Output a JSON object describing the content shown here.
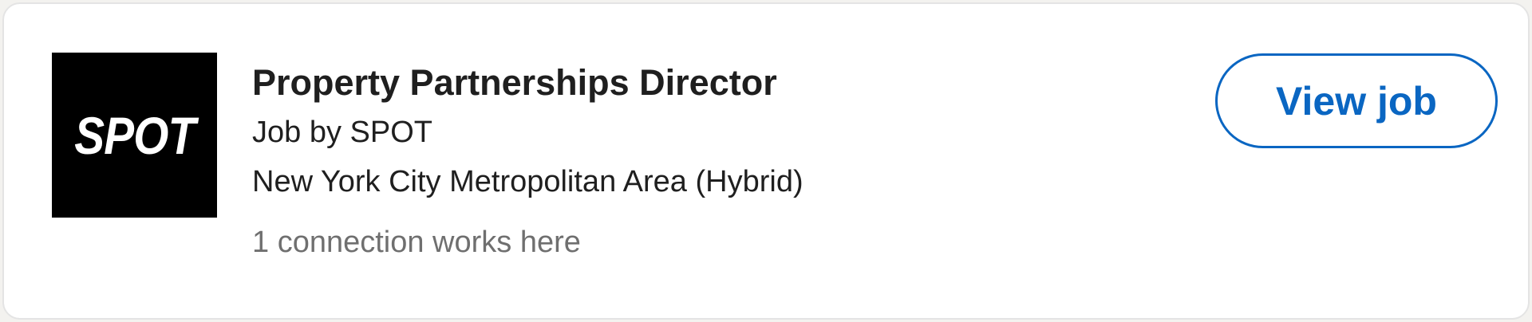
{
  "job": {
    "company_logo_text": "SPOT",
    "title": "Property Partnerships Director",
    "posted_by": "Job by SPOT",
    "location": "New York City Metropolitan Area (Hybrid)",
    "connections": "1 connection works here"
  },
  "actions": {
    "view_job_label": "View job"
  },
  "colors": {
    "accent": "#0a66c2",
    "logo_background": "#000000",
    "secondary_text": "#6f6f6f"
  }
}
